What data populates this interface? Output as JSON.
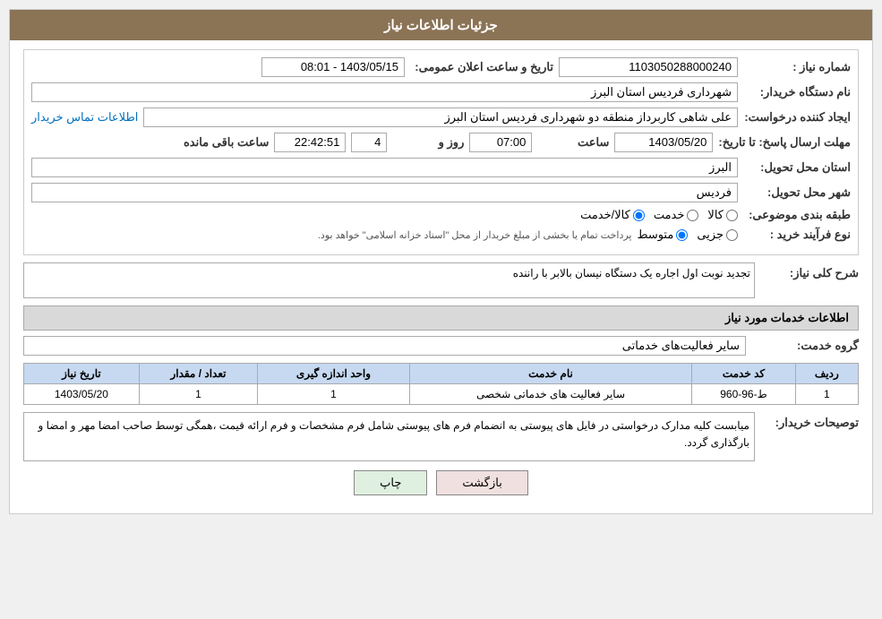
{
  "header": {
    "title": "جزئیات اطلاعات نیاز"
  },
  "fields": {
    "need_number_label": "شماره نیاز :",
    "need_number_value": "1103050288000240",
    "announcement_date_label": "تاریخ و ساعت اعلان عمومی:",
    "announcement_date_value": "1403/05/15 - 08:01",
    "buyer_org_label": "نام دستگاه خریدار:",
    "buyer_org_value": "شهرداری فردیس استان البرز",
    "creator_label": "ایجاد کننده درخواست:",
    "creator_value": "علی شاهی کاربرداز منطقه دو شهرداری فردیس استان البرز",
    "contact_link": "اطلاعات تماس خریدار",
    "response_deadline_label": "مهلت ارسال پاسخ: تا تاریخ:",
    "deadline_date": "1403/05/20",
    "deadline_time_label": "ساعت",
    "deadline_time": "07:00",
    "days_label": "روز و",
    "days_value": "4",
    "remaining_label": "ساعت باقی مانده",
    "remaining_time": "22:42:51",
    "province_label": "استان محل تحویل:",
    "province_value": "البرز",
    "city_label": "شهر محل تحویل:",
    "city_value": "فردیس",
    "category_label": "طبقه بندی موضوعی:",
    "category_radio1": "کالا",
    "category_radio2": "خدمت",
    "category_radio3": "کالا/خدمت",
    "purchase_type_label": "نوع فرآیند خرید :",
    "purchase_radio1": "جزیی",
    "purchase_radio2": "متوسط",
    "purchase_note": "پرداخت تمام یا بخشی از مبلغ خریدار از محل \"اسناد خزانه اسلامی\" خواهد بود.",
    "need_description_label": "شرح کلی نیاز:",
    "need_description_value": "تجدید نوبت اول اجاره یک دستگاه نیسان بالابر با راننده",
    "services_section_title": "اطلاعات خدمات مورد نیاز",
    "service_group_label": "گروه خدمت:",
    "service_group_value": "سایر فعالیت‌های خدماتی",
    "table": {
      "headers": [
        "ردیف",
        "کد خدمت",
        "نام خدمت",
        "واحد اندازه گیری",
        "تعداد / مقدار",
        "تاریخ نیاز"
      ],
      "rows": [
        {
          "row": "1",
          "code": "ط-96-960",
          "name": "سایر فعالیت های خدماتی شخصی",
          "unit": "1",
          "quantity": "1",
          "date": "1403/05/20"
        }
      ]
    },
    "buyer_notes_label": "توصیحات خریدار:",
    "buyer_notes_value": "میابست کلیه مدارک درخواستی در فایل های پیوستی به انضمام فرم های پیوستی شامل فرم مشخصات و فرم ارائه قیمت ،همگی توسط صاحب امضا مهر و امضا و بارگذاری گردد."
  },
  "buttons": {
    "back": "بازگشت",
    "print": "چاپ"
  }
}
